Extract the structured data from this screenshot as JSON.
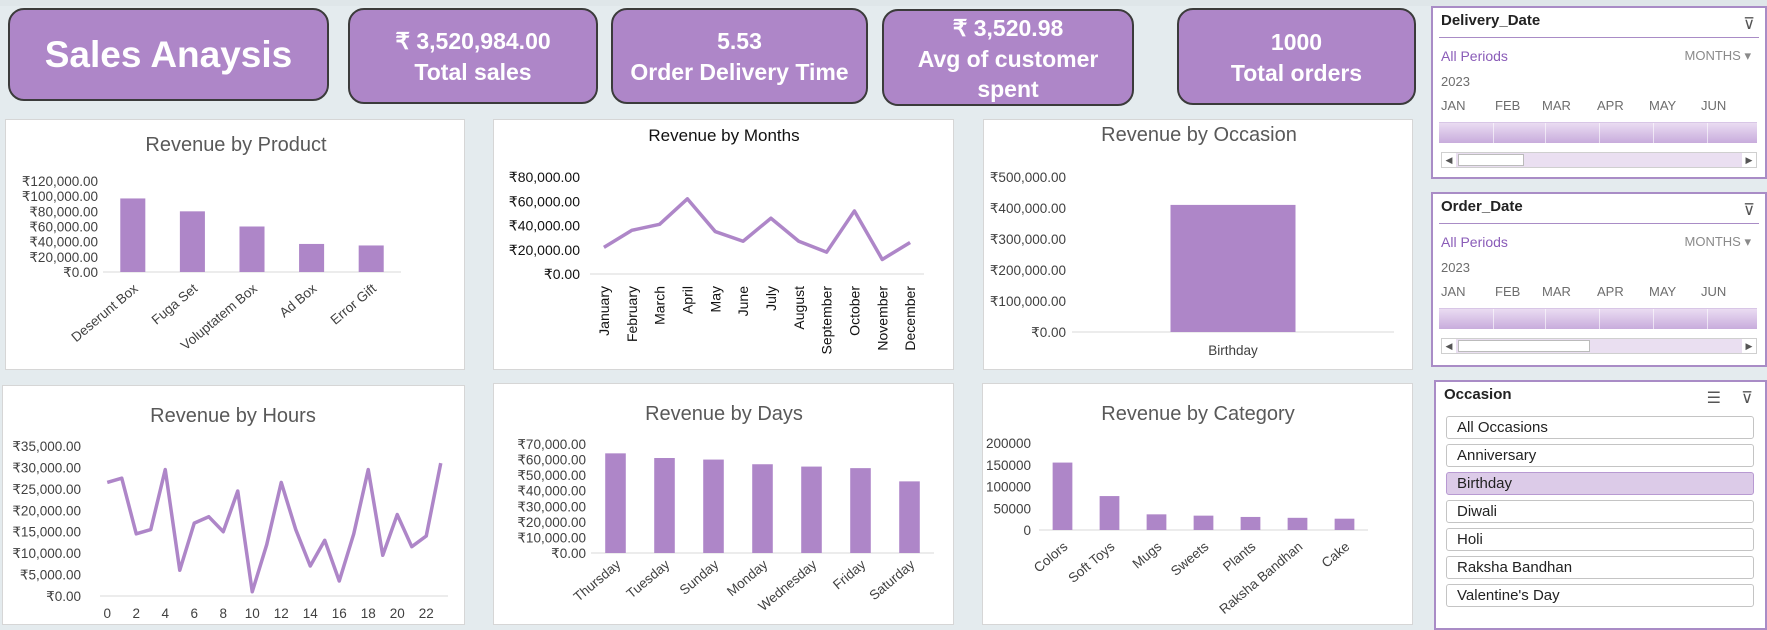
{
  "kpis": {
    "title": "Sales Anaysis",
    "total_sales": {
      "value": "₹ 3,520,984.00",
      "label": "Total sales"
    },
    "delivery": {
      "value": "5.53",
      "label": "Order Delivery Time"
    },
    "avg_spent": {
      "value": "₹ 3,520.98",
      "label": "Avg of customer spent"
    },
    "orders": {
      "value": "1000",
      "label": "Total orders"
    }
  },
  "slicers": {
    "delivery_date": {
      "title": "Delivery_Date",
      "all_label": "All Periods",
      "unit": "MONTHS",
      "year": "2023",
      "months": [
        "JAN",
        "FEB",
        "MAR",
        "APR",
        "MAY",
        "JUN"
      ]
    },
    "order_date": {
      "title": "Order_Date",
      "all_label": "All Periods",
      "unit": "MONTHS",
      "year": "2023",
      "months": [
        "JAN",
        "FEB",
        "MAR",
        "APR",
        "MAY",
        "JUN"
      ]
    },
    "occasion": {
      "title": "Occasion",
      "items": [
        "All Occasions",
        "Anniversary",
        "Birthday",
        "Diwali",
        "Holi",
        "Raksha Bandhan",
        "Valentine's Day"
      ],
      "selected": "Birthday"
    }
  },
  "chart_data": [
    {
      "type": "bar",
      "title": "Revenue by Product",
      "categories": [
        "Deserunt Box",
        "Fuga Set",
        "Voluptatem Box",
        "Ad Box",
        "Error Gift"
      ],
      "values": [
        97000,
        80000,
        60000,
        37000,
        35000
      ],
      "ylim": [
        0,
        120000
      ],
      "yticks": [
        "₹0.00",
        "₹20,000.00",
        "₹40,000.00",
        "₹60,000.00",
        "₹80,000.00",
        "₹100,000.00",
        "₹120,000.00"
      ],
      "color": "#ae86c8"
    },
    {
      "type": "line",
      "title": "Revenue by Months",
      "categories": [
        "January",
        "February",
        "March",
        "April",
        "May",
        "June",
        "July",
        "August",
        "September",
        "October",
        "November",
        "December"
      ],
      "values": [
        22000,
        36000,
        41000,
        62000,
        35000,
        27000,
        46000,
        27000,
        18000,
        52000,
        12000,
        26000
      ],
      "ylim": [
        0,
        80000
      ],
      "yticks": [
        "₹0.00",
        "₹20,000.00",
        "₹40,000.00",
        "₹60,000.00",
        "₹80,000.00"
      ],
      "color": "#ae86c8"
    },
    {
      "type": "bar",
      "title": "Revenue by Occasion",
      "categories": [
        "Birthday"
      ],
      "values": [
        410000
      ],
      "ylim": [
        0,
        500000
      ],
      "yticks": [
        "₹0.00",
        "₹100,000.00",
        "₹200,000.00",
        "₹300,000.00",
        "₹400,000.00",
        "₹500,000.00"
      ],
      "color": "#ae86c8"
    },
    {
      "type": "line",
      "title": "Revenue by Hours",
      "x": [
        0,
        1,
        2,
        3,
        4,
        5,
        6,
        7,
        8,
        9,
        10,
        11,
        12,
        13,
        14,
        15,
        16,
        17,
        18,
        19,
        20,
        21,
        22,
        23
      ],
      "values": [
        26500,
        27500,
        14500,
        15500,
        29500,
        6000,
        17000,
        18500,
        15000,
        24500,
        1000,
        12000,
        26500,
        15500,
        7000,
        13000,
        3500,
        14500,
        29500,
        9500,
        19000,
        11500,
        14000,
        31000
      ],
      "xticks": [
        "0",
        "2",
        "4",
        "6",
        "8",
        "10",
        "12",
        "14",
        "16",
        "18",
        "20",
        "22"
      ],
      "ylim": [
        0,
        35000
      ],
      "yticks": [
        "₹0.00",
        "₹5,000.00",
        "₹10,000.00",
        "₹15,000.00",
        "₹20,000.00",
        "₹25,000.00",
        "₹30,000.00",
        "₹35,000.00"
      ],
      "color": "#ae86c8"
    },
    {
      "type": "bar",
      "title": "Revenue by Days",
      "categories": [
        "Thursday",
        "Tuesday",
        "Sunday",
        "Monday",
        "Wednesday",
        "Friday",
        "Saturday"
      ],
      "values": [
        64000,
        61000,
        60000,
        57000,
        55500,
        54500,
        46000
      ],
      "ylim": [
        0,
        70000
      ],
      "yticks": [
        "₹0.00",
        "₹10,000.00",
        "₹20,000.00",
        "₹30,000.00",
        "₹40,000.00",
        "₹50,000.00",
        "₹60,000.00",
        "₹70,000.00"
      ],
      "color": "#ae86c8"
    },
    {
      "type": "bar",
      "title": "Revenue by Category",
      "categories": [
        "Colors",
        "Soft Toys",
        "Mugs",
        "Sweets",
        "Plants",
        "Raksha Bandhan",
        "Cake"
      ],
      "values": [
        155000,
        78000,
        36000,
        33000,
        30000,
        28000,
        26000
      ],
      "ylim": [
        0,
        200000
      ],
      "yticks": [
        "0",
        "50000",
        "100000",
        "150000",
        "200000"
      ],
      "color": "#ae86c8"
    }
  ]
}
